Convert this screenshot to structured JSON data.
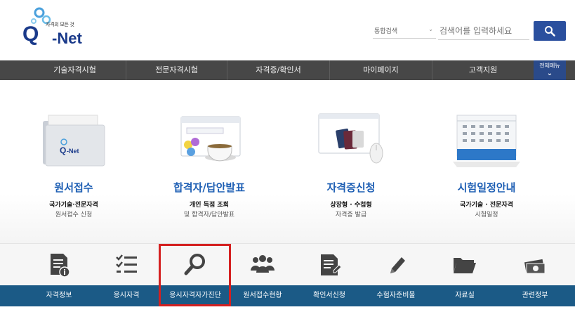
{
  "header": {
    "logo_tag": "자격의 모든 것",
    "logo_q": "Q",
    "logo_net": "-Net",
    "search_select_value": "통합검색",
    "search_placeholder": "검색어를 입력하세요",
    "search_button_icon": "search-icon",
    "brand_color": "#1a3a8a",
    "accent_color": "#2a4f9e"
  },
  "nav": {
    "items": [
      "기술자격시험",
      "전문자격시험",
      "자격증/확인서",
      "마이페이지",
      "고객지원"
    ],
    "all_menu_label": "전체메뉴"
  },
  "cards": [
    {
      "title": "원서접수",
      "line1": "국가기술·전문자격",
      "line2": "원서접수 신청",
      "icon": "folder-qnet-icon"
    },
    {
      "title": "합격자/답안발표",
      "line1": "개인 득점 조회",
      "line2": "및 합격자/답안발표",
      "icon": "browser-teacup-icon"
    },
    {
      "title": "자격증신청",
      "line1": "상장형 · 수첩형",
      "line2": "자격증 발급",
      "icon": "passport-mouse-icon"
    },
    {
      "title": "시험일정안내",
      "line1": "국가기술 · 전문자격",
      "line2": "시험일정",
      "icon": "calendar-icon"
    }
  ],
  "quick_menu": {
    "items": [
      {
        "label": "자격정보",
        "icon": "document-info-icon"
      },
      {
        "label": "응시자격",
        "icon": "checklist-icon"
      },
      {
        "label": "응시자격자가진단",
        "icon": "search-icon"
      },
      {
        "label": "원서접수현황",
        "icon": "people-icon"
      },
      {
        "label": "확인서신청",
        "icon": "document-edit-icon"
      },
      {
        "label": "수험자준비물",
        "icon": "pencil-icon"
      },
      {
        "label": "자료실",
        "icon": "folder-icon"
      },
      {
        "label": "관련정부",
        "icon": "money-icon"
      }
    ],
    "highlight_color": "#d42020",
    "bar_color": "#1b5a86"
  }
}
